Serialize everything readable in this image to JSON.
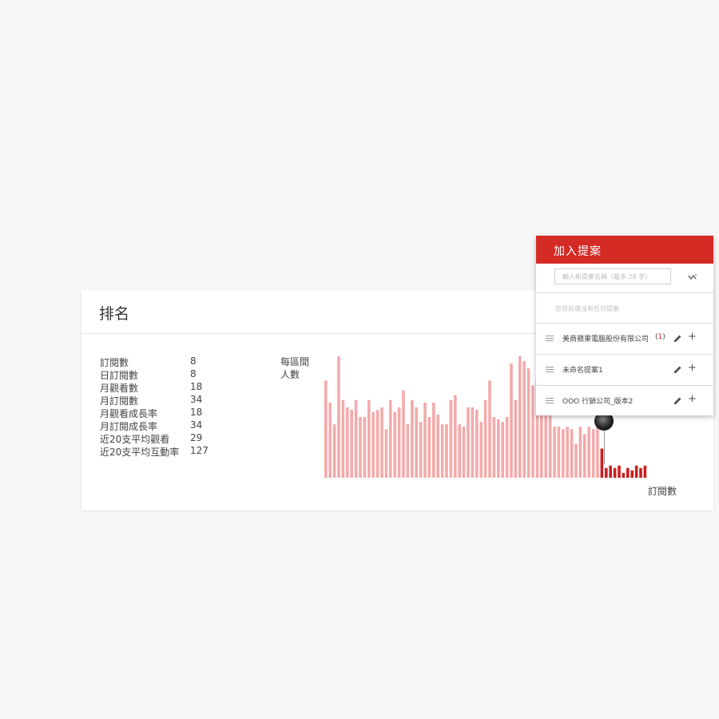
{
  "ranking_card": {
    "title": "排名",
    "stats": [
      {
        "label": "訂閱數",
        "value": "8"
      },
      {
        "label": "日訂閱數",
        "value": "8"
      },
      {
        "label": "月觀看數",
        "value": "18"
      },
      {
        "label": "月訂閱數",
        "value": "34"
      },
      {
        "label": "月觀看成長率",
        "value": "18"
      },
      {
        "label": "月訂閱成長率",
        "value": "34"
      },
      {
        "label": "近20支平均觀看",
        "value": "29"
      },
      {
        "label": "近20支平均互動率",
        "value": "127"
      }
    ]
  },
  "chart_data": {
    "type": "bar",
    "ylabel_line1": "每區間",
    "ylabel_line2": "人數",
    "xlabel": "訂閱數",
    "colors": {
      "normal": "#f4aaaa",
      "highlight": "#cc1f1f"
    },
    "values": [
      80,
      62,
      44,
      100,
      64,
      58,
      56,
      64,
      50,
      50,
      64,
      54,
      56,
      58,
      40,
      64,
      54,
      58,
      72,
      44,
      64,
      58,
      46,
      62,
      50,
      62,
      52,
      44,
      44,
      64,
      68,
      44,
      42,
      58,
      58,
      56,
      46,
      64,
      80,
      50,
      48,
      46,
      50,
      94,
      64,
      100,
      96,
      90,
      76,
      80,
      60,
      84,
      52,
      42,
      42,
      40,
      42,
      40,
      28,
      42,
      36,
      42,
      40,
      52,
      24,
      8,
      10,
      8,
      10,
      4,
      8,
      6,
      10,
      8,
      10
    ],
    "highlight_from_index": 64
  },
  "proposal_panel": {
    "title": "加入提案",
    "input_placeholder": "輸入新提案名稱（最多 28 字）",
    "empty_text": "您目前還沒有任何提案",
    "icons": {
      "trend": "trend-icon",
      "drag": "drag-handle-icon",
      "edit": "pencil-icon",
      "add": "plus-icon"
    },
    "items": [
      {
        "name": "美商蘋果電腦股份有限公司",
        "count_open": "(",
        "count": "1",
        "count_close": ")"
      },
      {
        "name": "未命名提案1",
        "count_open": "",
        "count": "",
        "count_close": ""
      },
      {
        "name": "OOO 行銷公司_版本2",
        "count_open": "",
        "count": "",
        "count_close": ""
      }
    ],
    "add_symbol": "+"
  }
}
